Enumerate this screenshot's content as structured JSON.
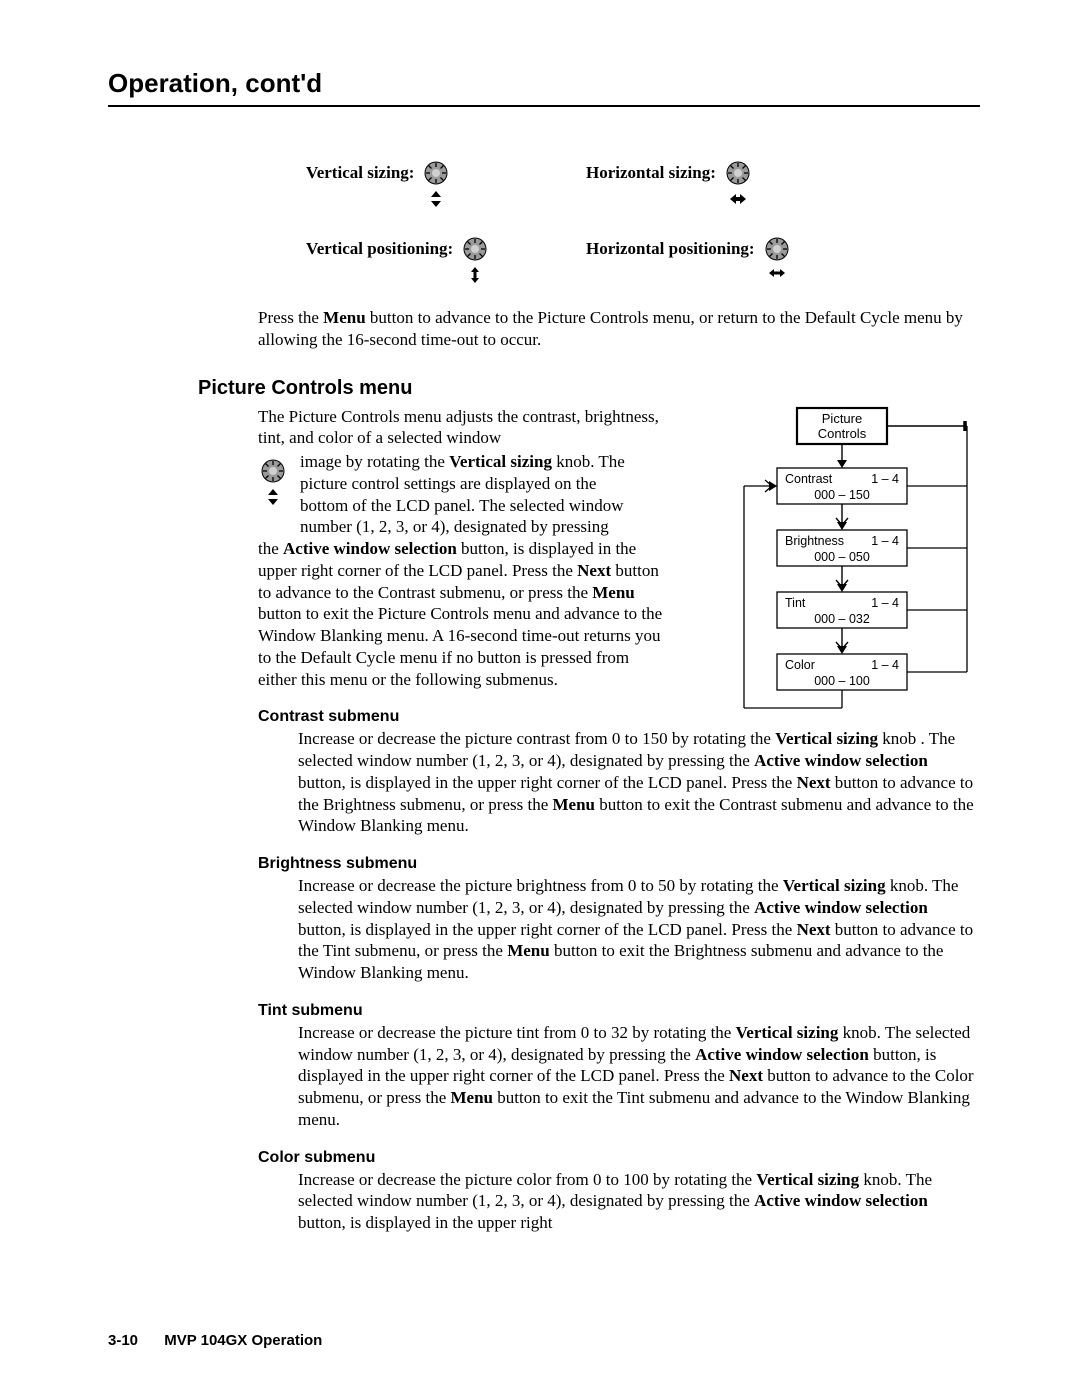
{
  "header": {
    "title": "Operation, cont'd"
  },
  "knobs": {
    "vs": "Vertical sizing:",
    "hs": "Horizontal sizing:",
    "vp": "Vertical positioning:",
    "hp": "Horizontal positioning:"
  },
  "intro": {
    "plain_html": "Press the <b>Menu</b> button to advance to the Picture Controls menu, or return to the Default Cycle menu by allowing the 16-second time-out to occur."
  },
  "section": {
    "title": "Picture Controls menu"
  },
  "pc": {
    "p1": "The Picture Controls menu adjusts the contrast, brightness, tint, and color of a selected window",
    "inset_html": "image by rotating the <b>Vertical sizing</b> knob.  The picture control settings are displayed on the bottom of the LCD panel.  The selected window number (1, 2, 3, or 4), designated by pressing",
    "p2_html": "the <b>Active window selection</b> button, is displayed in the upper right corner of the LCD panel.  Press the <b>Next</b> button to advance to the Contrast submenu, or press the <b>Menu</b> button to exit the Picture Controls menu and advance to the Window Blanking menu.  A 16-second time-out returns you to the Default Cycle menu if no button is pressed from either this menu or the following submenus."
  },
  "flow": {
    "root": "Picture\nControls",
    "nodes": [
      {
        "name": "Contrast",
        "win": "1 – 4",
        "range": "000 – 150"
      },
      {
        "name": "Brightness",
        "win": "1 – 4",
        "range": "000 – 050"
      },
      {
        "name": "Tint",
        "win": "1 – 4",
        "range": "000 – 032"
      },
      {
        "name": "Color",
        "win": "1 – 4",
        "range": "000 – 100"
      }
    ]
  },
  "subs": [
    {
      "title": "Contrast submenu",
      "body_html": "Increase or decrease the picture contrast from 0 to 150 by rotating the <b>Vertical sizing</b> knob .  The selected window number (1, 2, 3, or 4), designated by pressing the <b>Active window selection</b> button, is displayed in the upper right corner of the LCD panel.  Press the <b>Next</b> button to advance to the Brightness submenu, or press the <b>Menu</b> button to exit the Contrast submenu and advance to the Window Blanking menu."
    },
    {
      "title": "Brightness submenu",
      "body_html": "Increase or decrease the picture brightness from 0 to 50 by rotating the <b>Vertical sizing</b> knob.  The selected window number (1, 2, 3, or 4), designated by pressing the <b>Active window selection</b> button, is displayed in the upper right corner of the LCD panel.  Press the <b>Next</b> button to advance to the Tint submenu, or press the <b>Menu</b> button to exit the Brightness submenu and advance to the Window Blanking menu."
    },
    {
      "title": "Tint submenu",
      "body_html": "Increase or decrease the picture tint from 0 to 32 by rotating the <b>Vertical sizing</b> knob.  The selected window number (1, 2, 3, or 4), designated by pressing the <b>Active window selection</b> button, is displayed in the upper right corner of the LCD panel.  Press the <b>Next</b> button to advance to the Color submenu, or press the <b>Menu</b> button to exit the Tint submenu and advance to the Window Blanking menu."
    },
    {
      "title": "Color submenu",
      "body_html": "Increase or decrease the picture color from 0 to 100 by rotating the <b>Vertical sizing</b> knob.  The selected window number (1, 2, 3, or 4), designated by pressing the <b>Active window selection</b> button, is displayed in the upper right"
    }
  ],
  "footer": {
    "page": "3-10",
    "doc": "MVP 104GX Operation"
  }
}
